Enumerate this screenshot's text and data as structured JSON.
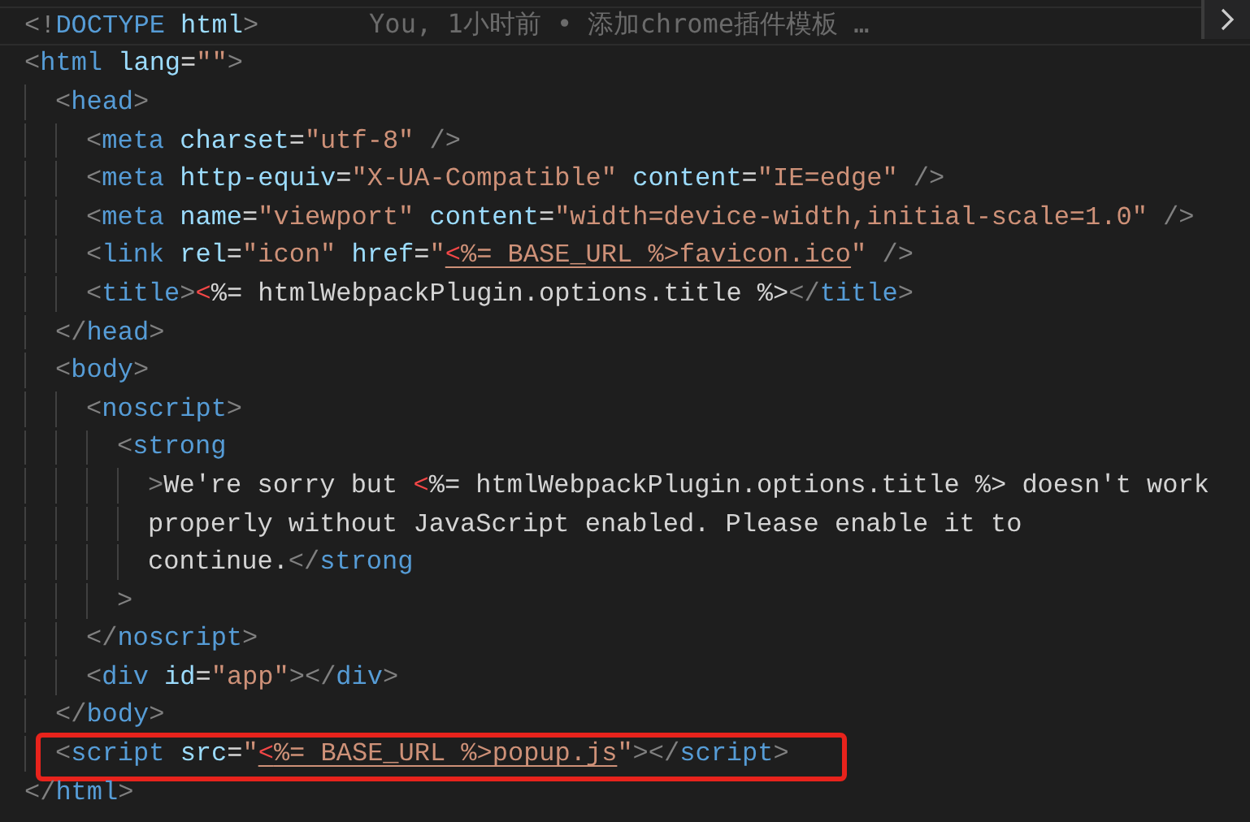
{
  "editor": {
    "lines": [
      {
        "boxed": false,
        "blame": "You, 1小时前 • 添加chrome插件模板 …",
        "tokens": [
          {
            "kind": "p",
            "text": "<!"
          },
          {
            "kind": "tag",
            "text": "DOCTYPE"
          },
          {
            "kind": "attr",
            "text": " html"
          },
          {
            "kind": "p",
            "text": ">"
          }
        ]
      },
      {
        "boxed": false,
        "tokens": [
          {
            "kind": "p",
            "text": "<"
          },
          {
            "kind": "tag",
            "text": "html"
          },
          {
            "kind": "attr",
            "text": " lang"
          },
          {
            "kind": "txt",
            "text": "="
          },
          {
            "kind": "str",
            "text": "\"\""
          },
          {
            "kind": "p",
            "text": ">"
          }
        ],
        "children": [
          {
            "boxed": false,
            "tokens": [
              {
                "kind": "p",
                "text": "<"
              },
              {
                "kind": "tag",
                "text": "head"
              },
              {
                "kind": "p",
                "text": ">"
              }
            ],
            "children": [
              {
                "boxed": false,
                "tokens": [
                  {
                    "kind": "p",
                    "text": "<"
                  },
                  {
                    "kind": "tag",
                    "text": "meta"
                  },
                  {
                    "kind": "attr",
                    "text": " charset"
                  },
                  {
                    "kind": "txt",
                    "text": "="
                  },
                  {
                    "kind": "str",
                    "text": "\"utf-8\""
                  },
                  {
                    "kind": "p",
                    "text": " />"
                  }
                ]
              },
              {
                "boxed": false,
                "tokens": [
                  {
                    "kind": "p",
                    "text": "<"
                  },
                  {
                    "kind": "tag",
                    "text": "meta"
                  },
                  {
                    "kind": "attr",
                    "text": " http-equiv"
                  },
                  {
                    "kind": "txt",
                    "text": "="
                  },
                  {
                    "kind": "str",
                    "text": "\"X-UA-Compatible\""
                  },
                  {
                    "kind": "attr",
                    "text": " content"
                  },
                  {
                    "kind": "txt",
                    "text": "="
                  },
                  {
                    "kind": "str",
                    "text": "\"IE=edge\""
                  },
                  {
                    "kind": "p",
                    "text": " />"
                  }
                ]
              },
              {
                "boxed": false,
                "tokens": [
                  {
                    "kind": "p",
                    "text": "<"
                  },
                  {
                    "kind": "tag",
                    "text": "meta"
                  },
                  {
                    "kind": "attr",
                    "text": " name"
                  },
                  {
                    "kind": "txt",
                    "text": "="
                  },
                  {
                    "kind": "str",
                    "text": "\"viewport\""
                  },
                  {
                    "kind": "attr",
                    "text": " content"
                  },
                  {
                    "kind": "txt",
                    "text": "="
                  },
                  {
                    "kind": "str",
                    "text": "\"width=device-width,initial-scale=1.0\""
                  },
                  {
                    "kind": "p",
                    "text": " />"
                  }
                ]
              },
              {
                "boxed": false,
                "tokens": [
                  {
                    "kind": "p",
                    "text": "<"
                  },
                  {
                    "kind": "tag",
                    "text": "link"
                  },
                  {
                    "kind": "attr",
                    "text": " rel"
                  },
                  {
                    "kind": "txt",
                    "text": "="
                  },
                  {
                    "kind": "str",
                    "text": "\"icon\""
                  },
                  {
                    "kind": "attr",
                    "text": " href"
                  },
                  {
                    "kind": "txt",
                    "text": "="
                  },
                  {
                    "kind": "str",
                    "text": "\""
                  },
                  {
                    "kind": "link",
                    "parts": [
                      {
                        "kind": "err",
                        "text": "<"
                      },
                      {
                        "kind": "str",
                        "text": "%= BASE_URL %>favicon.ico"
                      }
                    ]
                  },
                  {
                    "kind": "str",
                    "text": "\""
                  },
                  {
                    "kind": "p",
                    "text": " />"
                  }
                ]
              },
              {
                "boxed": false,
                "tokens": [
                  {
                    "kind": "p",
                    "text": "<"
                  },
                  {
                    "kind": "tag",
                    "text": "title"
                  },
                  {
                    "kind": "p",
                    "text": ">"
                  },
                  {
                    "kind": "err",
                    "text": "<"
                  },
                  {
                    "kind": "txt",
                    "text": "%= htmlWebpackPlugin.options.title %>"
                  },
                  {
                    "kind": "p",
                    "text": "</"
                  },
                  {
                    "kind": "tag",
                    "text": "title"
                  },
                  {
                    "kind": "p",
                    "text": ">"
                  }
                ]
              }
            ]
          },
          {
            "boxed": false,
            "tokens": [
              {
                "kind": "p",
                "text": "</"
              },
              {
                "kind": "tag",
                "text": "head"
              },
              {
                "kind": "p",
                "text": ">"
              }
            ]
          },
          {
            "boxed": false,
            "tokens": [
              {
                "kind": "p",
                "text": "<"
              },
              {
                "kind": "tag",
                "text": "body"
              },
              {
                "kind": "p",
                "text": ">"
              }
            ],
            "children": [
              {
                "boxed": false,
                "tokens": [
                  {
                    "kind": "p",
                    "text": "<"
                  },
                  {
                    "kind": "tag",
                    "text": "noscript"
                  },
                  {
                    "kind": "p",
                    "text": ">"
                  }
                ],
                "children": [
                  {
                    "boxed": false,
                    "tokens": [
                      {
                        "kind": "p",
                        "text": "<"
                      },
                      {
                        "kind": "tag",
                        "text": "strong"
                      }
                    ],
                    "children": [
                      {
                        "boxed": false,
                        "tokens": [
                          {
                            "kind": "p",
                            "text": ">"
                          },
                          {
                            "kind": "txt",
                            "text": "We're sorry but "
                          },
                          {
                            "kind": "err",
                            "text": "<"
                          },
                          {
                            "kind": "txt",
                            "text": "%= htmlWebpackPlugin.options.title %> doesn't work"
                          }
                        ]
                      },
                      {
                        "boxed": false,
                        "tokens": [
                          {
                            "kind": "txt",
                            "text": "properly without JavaScript enabled. Please enable it to"
                          }
                        ]
                      },
                      {
                        "boxed": false,
                        "tokens": [
                          {
                            "kind": "txt",
                            "text": "continue."
                          },
                          {
                            "kind": "p",
                            "text": "</"
                          },
                          {
                            "kind": "tag",
                            "text": "strong"
                          }
                        ]
                      }
                    ]
                  },
                  {
                    "boxed": false,
                    "tokens": [
                      {
                        "kind": "p",
                        "text": ">"
                      }
                    ]
                  }
                ]
              },
              {
                "boxed": false,
                "tokens": [
                  {
                    "kind": "p",
                    "text": "</"
                  },
                  {
                    "kind": "tag",
                    "text": "noscript"
                  },
                  {
                    "kind": "p",
                    "text": ">"
                  }
                ]
              },
              {
                "boxed": false,
                "tokens": [
                  {
                    "kind": "p",
                    "text": "<"
                  },
                  {
                    "kind": "tag",
                    "text": "div"
                  },
                  {
                    "kind": "attr",
                    "text": " id"
                  },
                  {
                    "kind": "txt",
                    "text": "="
                  },
                  {
                    "kind": "str",
                    "text": "\"app\""
                  },
                  {
                    "kind": "p",
                    "text": "></"
                  },
                  {
                    "kind": "tag",
                    "text": "div"
                  },
                  {
                    "kind": "p",
                    "text": ">"
                  }
                ]
              }
            ]
          },
          {
            "boxed": false,
            "tokens": [
              {
                "kind": "p",
                "text": "</"
              },
              {
                "kind": "tag",
                "text": "body"
              },
              {
                "kind": "p",
                "text": ">"
              }
            ]
          },
          {
            "boxed": true,
            "tokens": [
              {
                "kind": "p",
                "text": "<"
              },
              {
                "kind": "tag",
                "text": "script"
              },
              {
                "kind": "attr",
                "text": " src"
              },
              {
                "kind": "txt",
                "text": "="
              },
              {
                "kind": "str",
                "text": "\""
              },
              {
                "kind": "link",
                "parts": [
                  {
                    "kind": "err",
                    "text": "<"
                  },
                  {
                    "kind": "str",
                    "text": "%= BASE_URL %>popup.js"
                  }
                ]
              },
              {
                "kind": "str",
                "text": "\""
              },
              {
                "kind": "p",
                "text": "></"
              },
              {
                "kind": "tag",
                "text": "script"
              },
              {
                "kind": "p",
                "text": ">"
              }
            ]
          }
        ]
      },
      {
        "boxed": false,
        "tokens": [
          {
            "kind": "p",
            "text": "</"
          },
          {
            "kind": "tag",
            "text": "html"
          },
          {
            "kind": "p",
            "text": ">"
          }
        ]
      }
    ]
  }
}
